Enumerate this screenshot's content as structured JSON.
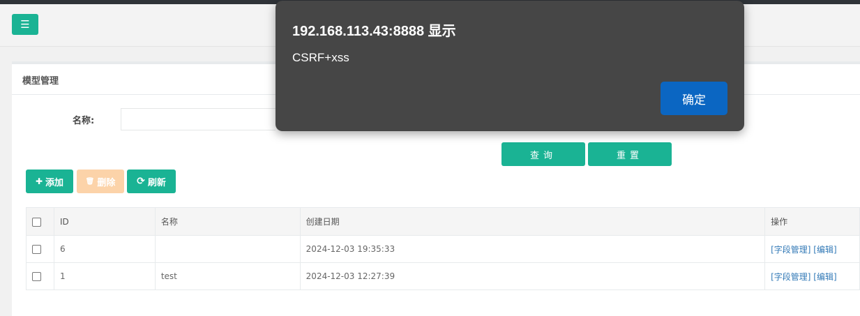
{
  "header": {
    "menu_icon": "☰"
  },
  "panel": {
    "title": "模型管理"
  },
  "search": {
    "name_label": "名称:",
    "name_value": "",
    "query_label": "查询",
    "reset_label": "重置"
  },
  "toolbar": {
    "add_icon": "✚",
    "add_label": "添加",
    "delete_icon": "🗑",
    "delete_label": "删除",
    "refresh_icon": "⟳",
    "refresh_label": "刷新"
  },
  "table": {
    "headers": [
      "ID",
      "名称",
      "创建日期",
      "操作"
    ],
    "rows": [
      {
        "id": "6",
        "name": "",
        "created": "2024-12-03 19:35:33",
        "action_fields": "[字段管理]",
        "action_edit": "[编辑]"
      },
      {
        "id": "1",
        "name": "test",
        "created": "2024-12-03 12:27:39",
        "action_fields": "[字段管理]",
        "action_edit": "[编辑]"
      }
    ]
  },
  "dialog": {
    "title": "192.168.113.43:8888 显示",
    "message": "CSRF+xss",
    "ok_label": "确定"
  },
  "colors": {
    "primary": "#1ab394",
    "disabled": "#fcd3a9",
    "dialog_bg": "#464646",
    "dialog_button": "#0b66c2",
    "link": "#337ab7"
  }
}
